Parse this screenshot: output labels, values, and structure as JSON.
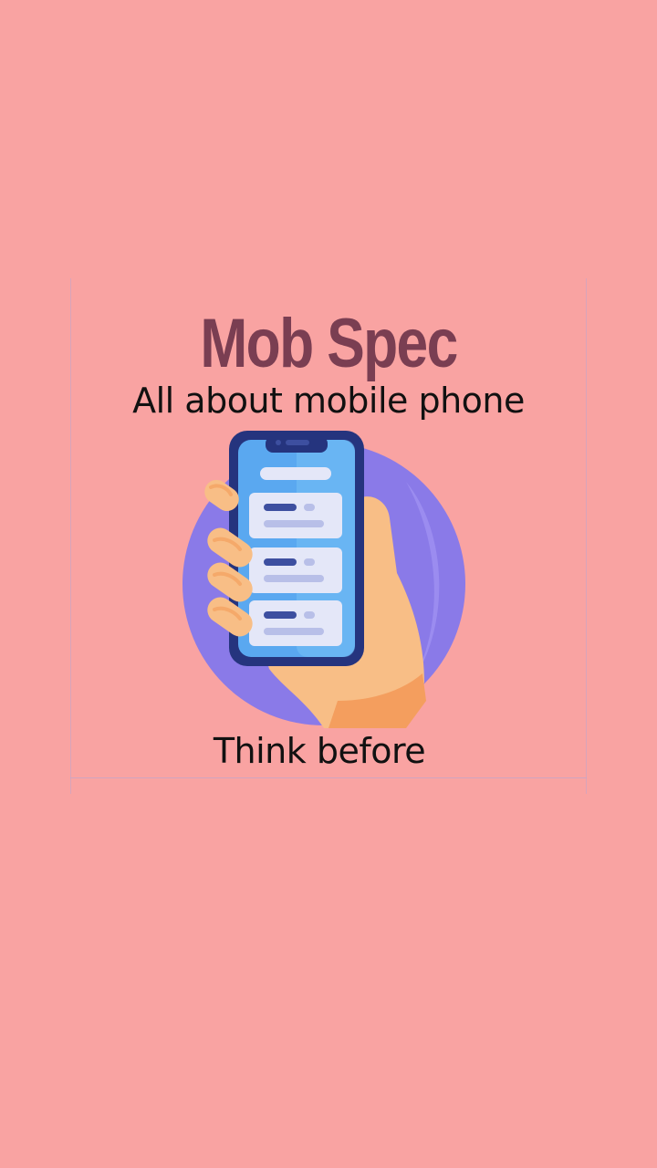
{
  "splash": {
    "title": "Mob Spec",
    "tagline": "All about mobile phone",
    "footer": "Think before",
    "illustration_icon": "hand-holding-phone-icon"
  },
  "colors": {
    "background": "#f9a3a2",
    "title": "#7a3e52",
    "text": "#111111",
    "circle": "#8a7ae8",
    "phone_body": "#25347e",
    "screen": "#5aa8f0",
    "card": "#e4e7f8",
    "hand": "#f8be86"
  }
}
